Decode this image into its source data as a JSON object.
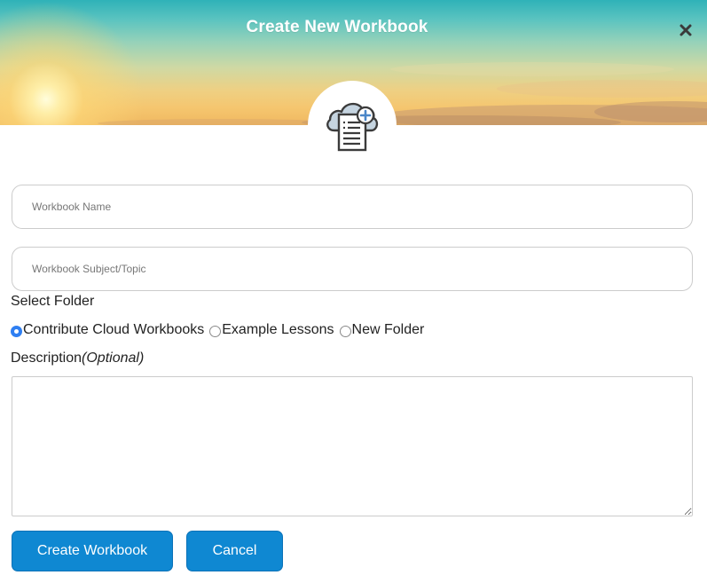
{
  "modal": {
    "title": "Create New Workbook",
    "close_icon": "close-icon"
  },
  "badge": {
    "icon": "cloud-document-add-icon"
  },
  "form": {
    "name_placeholder": "Workbook Name",
    "name_value": "",
    "subject_placeholder": "Workbook Subject/Topic",
    "subject_value": "",
    "folder_label": "Select Folder",
    "folders": [
      {
        "label": "Contribute Cloud Workbooks",
        "checked": true
      },
      {
        "label": "Example Lessons",
        "checked": false
      },
      {
        "label": "New Folder",
        "checked": false
      }
    ],
    "description_label": "Description",
    "description_optional": "(Optional)",
    "description_value": ""
  },
  "actions": {
    "create_label": "Create Workbook",
    "cancel_label": "Cancel"
  },
  "colors": {
    "primary_button": "#0f88d2",
    "radio_checked": "#2f7ff2",
    "input_border": "#cccccc"
  }
}
